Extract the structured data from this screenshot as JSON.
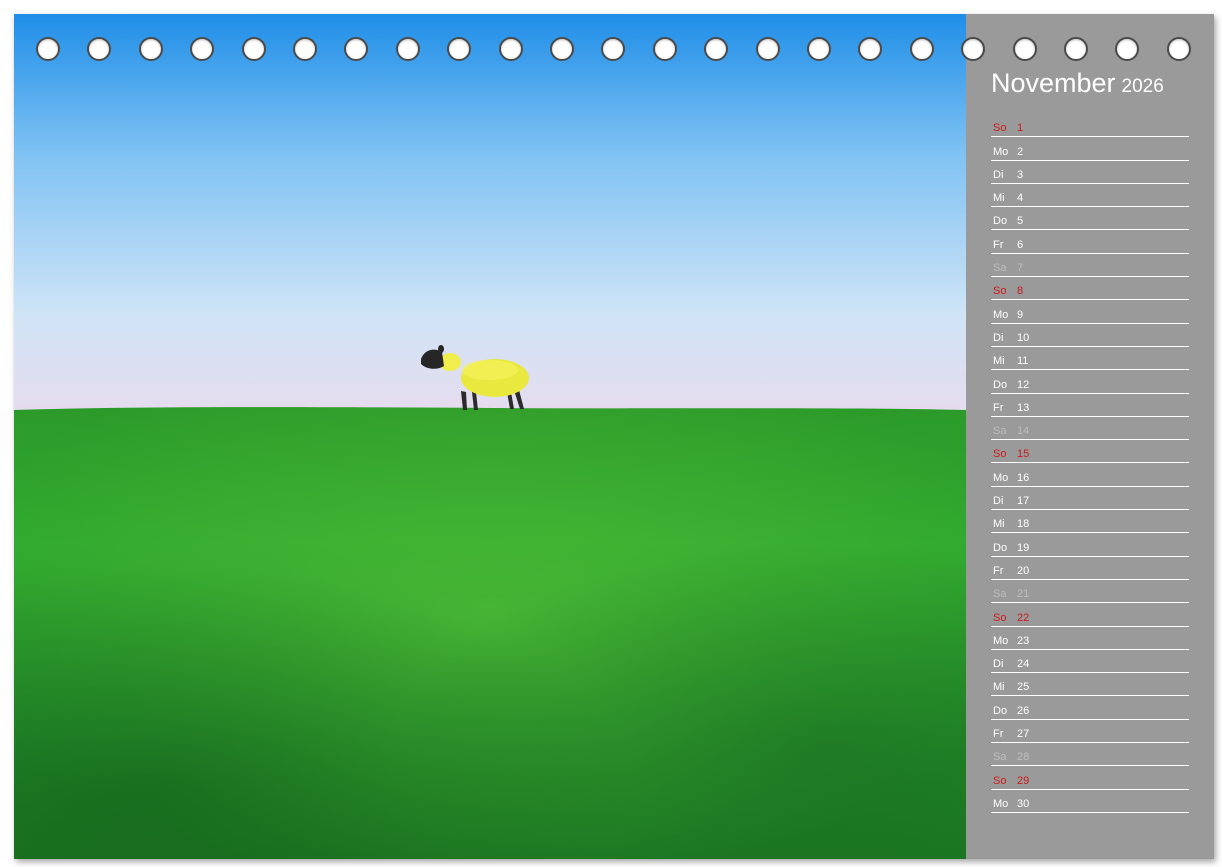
{
  "calendar": {
    "month": "November",
    "year": "2026",
    "colors": {
      "sunday": "#cc1b1b",
      "saturday": "#bdbdbd",
      "weekday": "#ffffff",
      "panel": "#9a9a9a"
    },
    "days": [
      {
        "wd": "So",
        "num": "1"
      },
      {
        "wd": "Mo",
        "num": "2"
      },
      {
        "wd": "Di",
        "num": "3"
      },
      {
        "wd": "Mi",
        "num": "4"
      },
      {
        "wd": "Do",
        "num": "5"
      },
      {
        "wd": "Fr",
        "num": "6"
      },
      {
        "wd": "Sa",
        "num": "7"
      },
      {
        "wd": "So",
        "num": "8"
      },
      {
        "wd": "Mo",
        "num": "9"
      },
      {
        "wd": "Di",
        "num": "10"
      },
      {
        "wd": "Mi",
        "num": "11"
      },
      {
        "wd": "Do",
        "num": "12"
      },
      {
        "wd": "Fr",
        "num": "13"
      },
      {
        "wd": "Sa",
        "num": "14"
      },
      {
        "wd": "So",
        "num": "15"
      },
      {
        "wd": "Mo",
        "num": "16"
      },
      {
        "wd": "Di",
        "num": "17"
      },
      {
        "wd": "Mi",
        "num": "18"
      },
      {
        "wd": "Do",
        "num": "19"
      },
      {
        "wd": "Fr",
        "num": "20"
      },
      {
        "wd": "Sa",
        "num": "21"
      },
      {
        "wd": "So",
        "num": "22"
      },
      {
        "wd": "Mo",
        "num": "23"
      },
      {
        "wd": "Di",
        "num": "24"
      },
      {
        "wd": "Mi",
        "num": "25"
      },
      {
        "wd": "Do",
        "num": "26"
      },
      {
        "wd": "Fr",
        "num": "27"
      },
      {
        "wd": "Sa",
        "num": "28"
      },
      {
        "wd": "So",
        "num": "29"
      },
      {
        "wd": "Mo",
        "num": "30"
      }
    ]
  }
}
